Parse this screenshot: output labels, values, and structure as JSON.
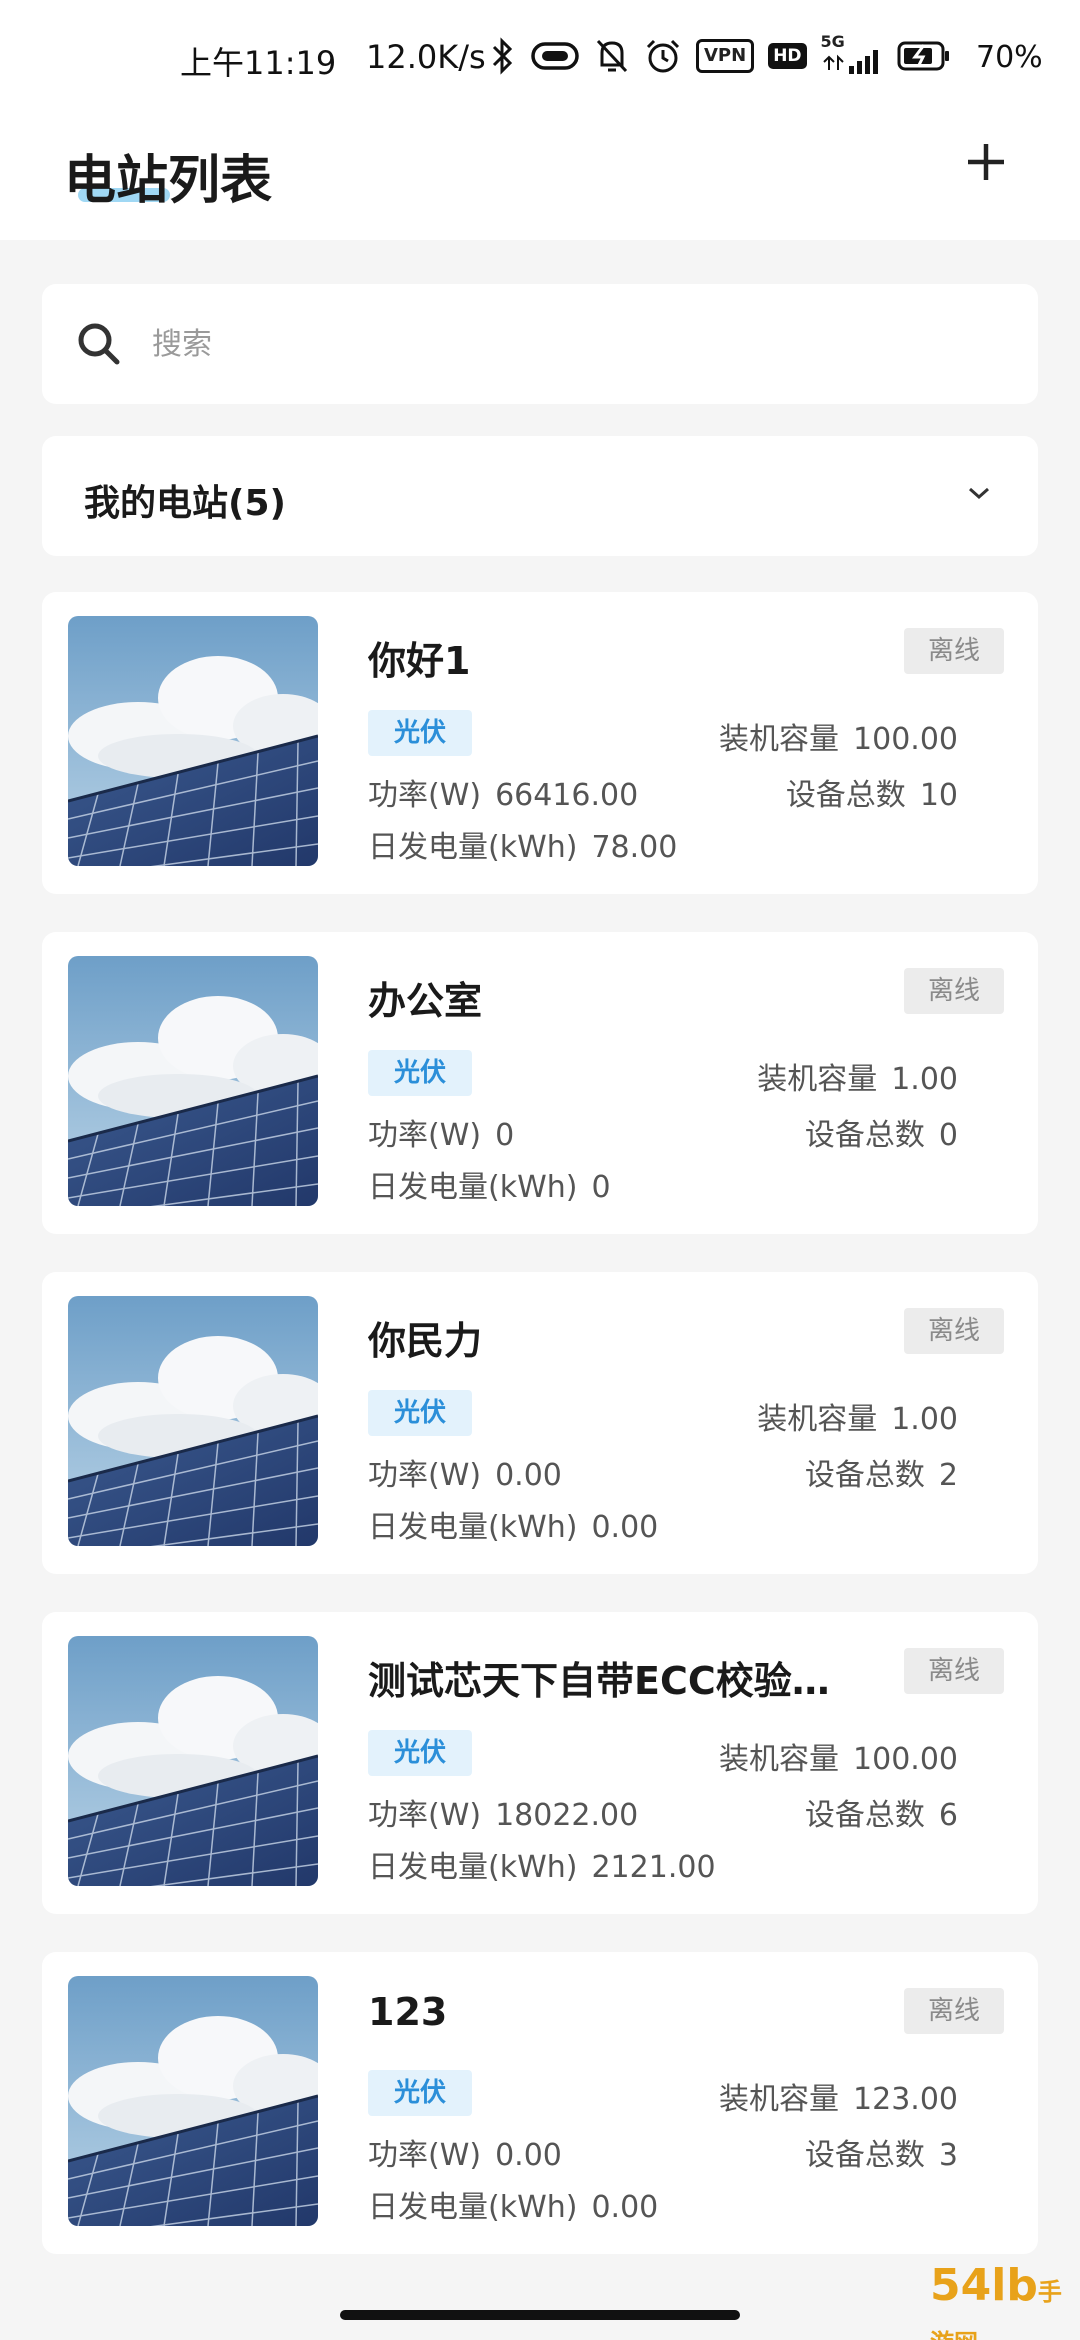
{
  "status_bar": {
    "time": "上午11:19",
    "net_speed": "12.0K/s",
    "vpn": "VPN",
    "hd": "HD",
    "signal": "5G",
    "battery_percent": "70%",
    "icons": [
      "bluetooth-icon",
      "link-icon",
      "mute-bell-icon",
      "alarm-icon",
      "vpn-icon",
      "hd-icon",
      "signal-icon",
      "battery-icon"
    ]
  },
  "header": {
    "title": "电站列表",
    "add_icon": "plus-icon"
  },
  "search": {
    "placeholder": "搜索",
    "icon": "search-icon"
  },
  "group": {
    "label": "我的电站(5)",
    "icon": "chevron-down-icon"
  },
  "labels": {
    "capacity": "装机容量",
    "power": "功率(W)",
    "device_count": "设备总数",
    "daily_energy": "日发电量(kWh)"
  },
  "stations": [
    {
      "name": "你好1",
      "status": "离线",
      "type": "光伏",
      "capacity": "100.00",
      "power": "66416.00",
      "device_count": "10",
      "daily_energy": "78.00"
    },
    {
      "name": "办公室",
      "status": "离线",
      "type": "光伏",
      "capacity": "1.00",
      "power": "0",
      "device_count": "0",
      "daily_energy": "0"
    },
    {
      "name": "你民力",
      "status": "离线",
      "type": "光伏",
      "capacity": "1.00",
      "power": "0.00",
      "device_count": "2",
      "daily_energy": "0.00"
    },
    {
      "name": "测试芯天下自带ECC校验…",
      "status": "离线",
      "type": "光伏",
      "capacity": "100.00",
      "power": "18022.00",
      "device_count": "6",
      "daily_energy": "2121.00"
    },
    {
      "name": "123",
      "status": "离线",
      "type": "光伏",
      "capacity": "123.00",
      "power": "0.00",
      "device_count": "3",
      "daily_energy": "0.00"
    }
  ],
  "watermark": {
    "text": "54lb",
    "sub": "手游网"
  },
  "colors": {
    "accent": "#2b8fd9",
    "type_badge_bg": "#e3f2fc",
    "status_badge_bg": "#ececec",
    "title_underline": "#8fd1f2"
  }
}
